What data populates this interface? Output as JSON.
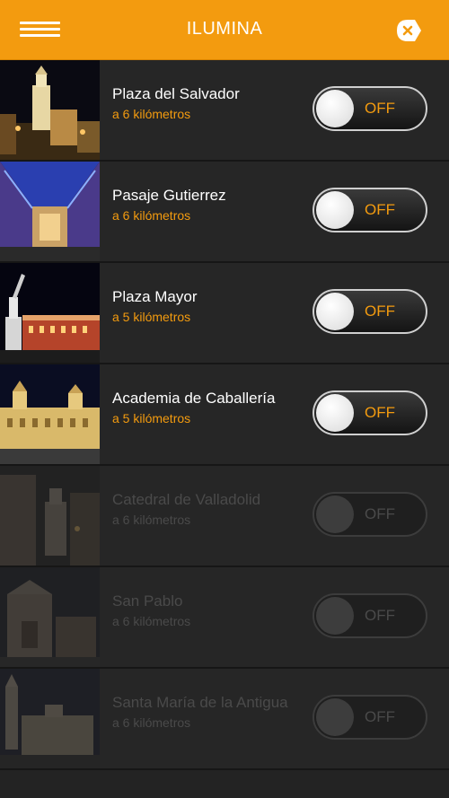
{
  "app": {
    "title": "ILUMINA",
    "icons": {
      "menu": "hamburger-menu-icon",
      "close": "close-tag-icon"
    },
    "colors": {
      "accent": "#f39b0f",
      "background": "#232323"
    }
  },
  "places": [
    {
      "name": "Plaza del Salvador",
      "distance": "a 6 kilómetros",
      "toggle": "OFF",
      "enabled": true
    },
    {
      "name": "Pasaje Gutierrez",
      "distance": "a 6 kilómetros",
      "toggle": "OFF",
      "enabled": true
    },
    {
      "name": "Plaza Mayor",
      "distance": "a 5 kilómetros",
      "toggle": "OFF",
      "enabled": true
    },
    {
      "name": "Academia de Caballería",
      "distance": "a 5 kilómetros",
      "toggle": "OFF",
      "enabled": true
    },
    {
      "name": "Catedral de Valladolid",
      "distance": "a 6 kilómetros",
      "toggle": "OFF",
      "enabled": false
    },
    {
      "name": "San Pablo",
      "distance": "a 6 kilómetros",
      "toggle": "OFF",
      "enabled": false
    },
    {
      "name": "Santa María de la Antigua",
      "distance": "a 6 kilómetros",
      "toggle": "OFF",
      "enabled": false
    }
  ]
}
